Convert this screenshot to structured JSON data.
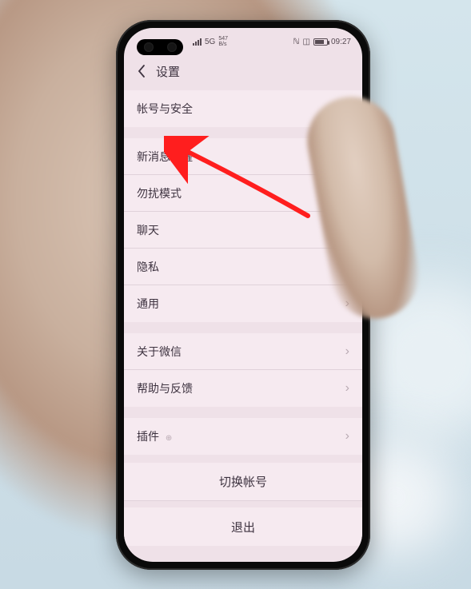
{
  "status_bar": {
    "network": "5G",
    "speed_top": "547",
    "speed_bottom": "B/s",
    "vibrate": "⬚",
    "time": "09:27"
  },
  "nav": {
    "title": "设置"
  },
  "group1": [
    {
      "label": "帐号与安全"
    }
  ],
  "group2": [
    {
      "label": "新消息提醒"
    },
    {
      "label": "勿扰模式"
    },
    {
      "label": "聊天"
    },
    {
      "label": "隐私"
    },
    {
      "label": "通用"
    }
  ],
  "group3": [
    {
      "label": "关于微信"
    },
    {
      "label": "帮助与反馈"
    }
  ],
  "group4": [
    {
      "label": "插件",
      "badge": "⊕"
    }
  ],
  "actions": {
    "switch": "切换帐号",
    "logout": "退出"
  },
  "annotation": {
    "target": "新消息提醒",
    "color": "#ff1e1e"
  }
}
